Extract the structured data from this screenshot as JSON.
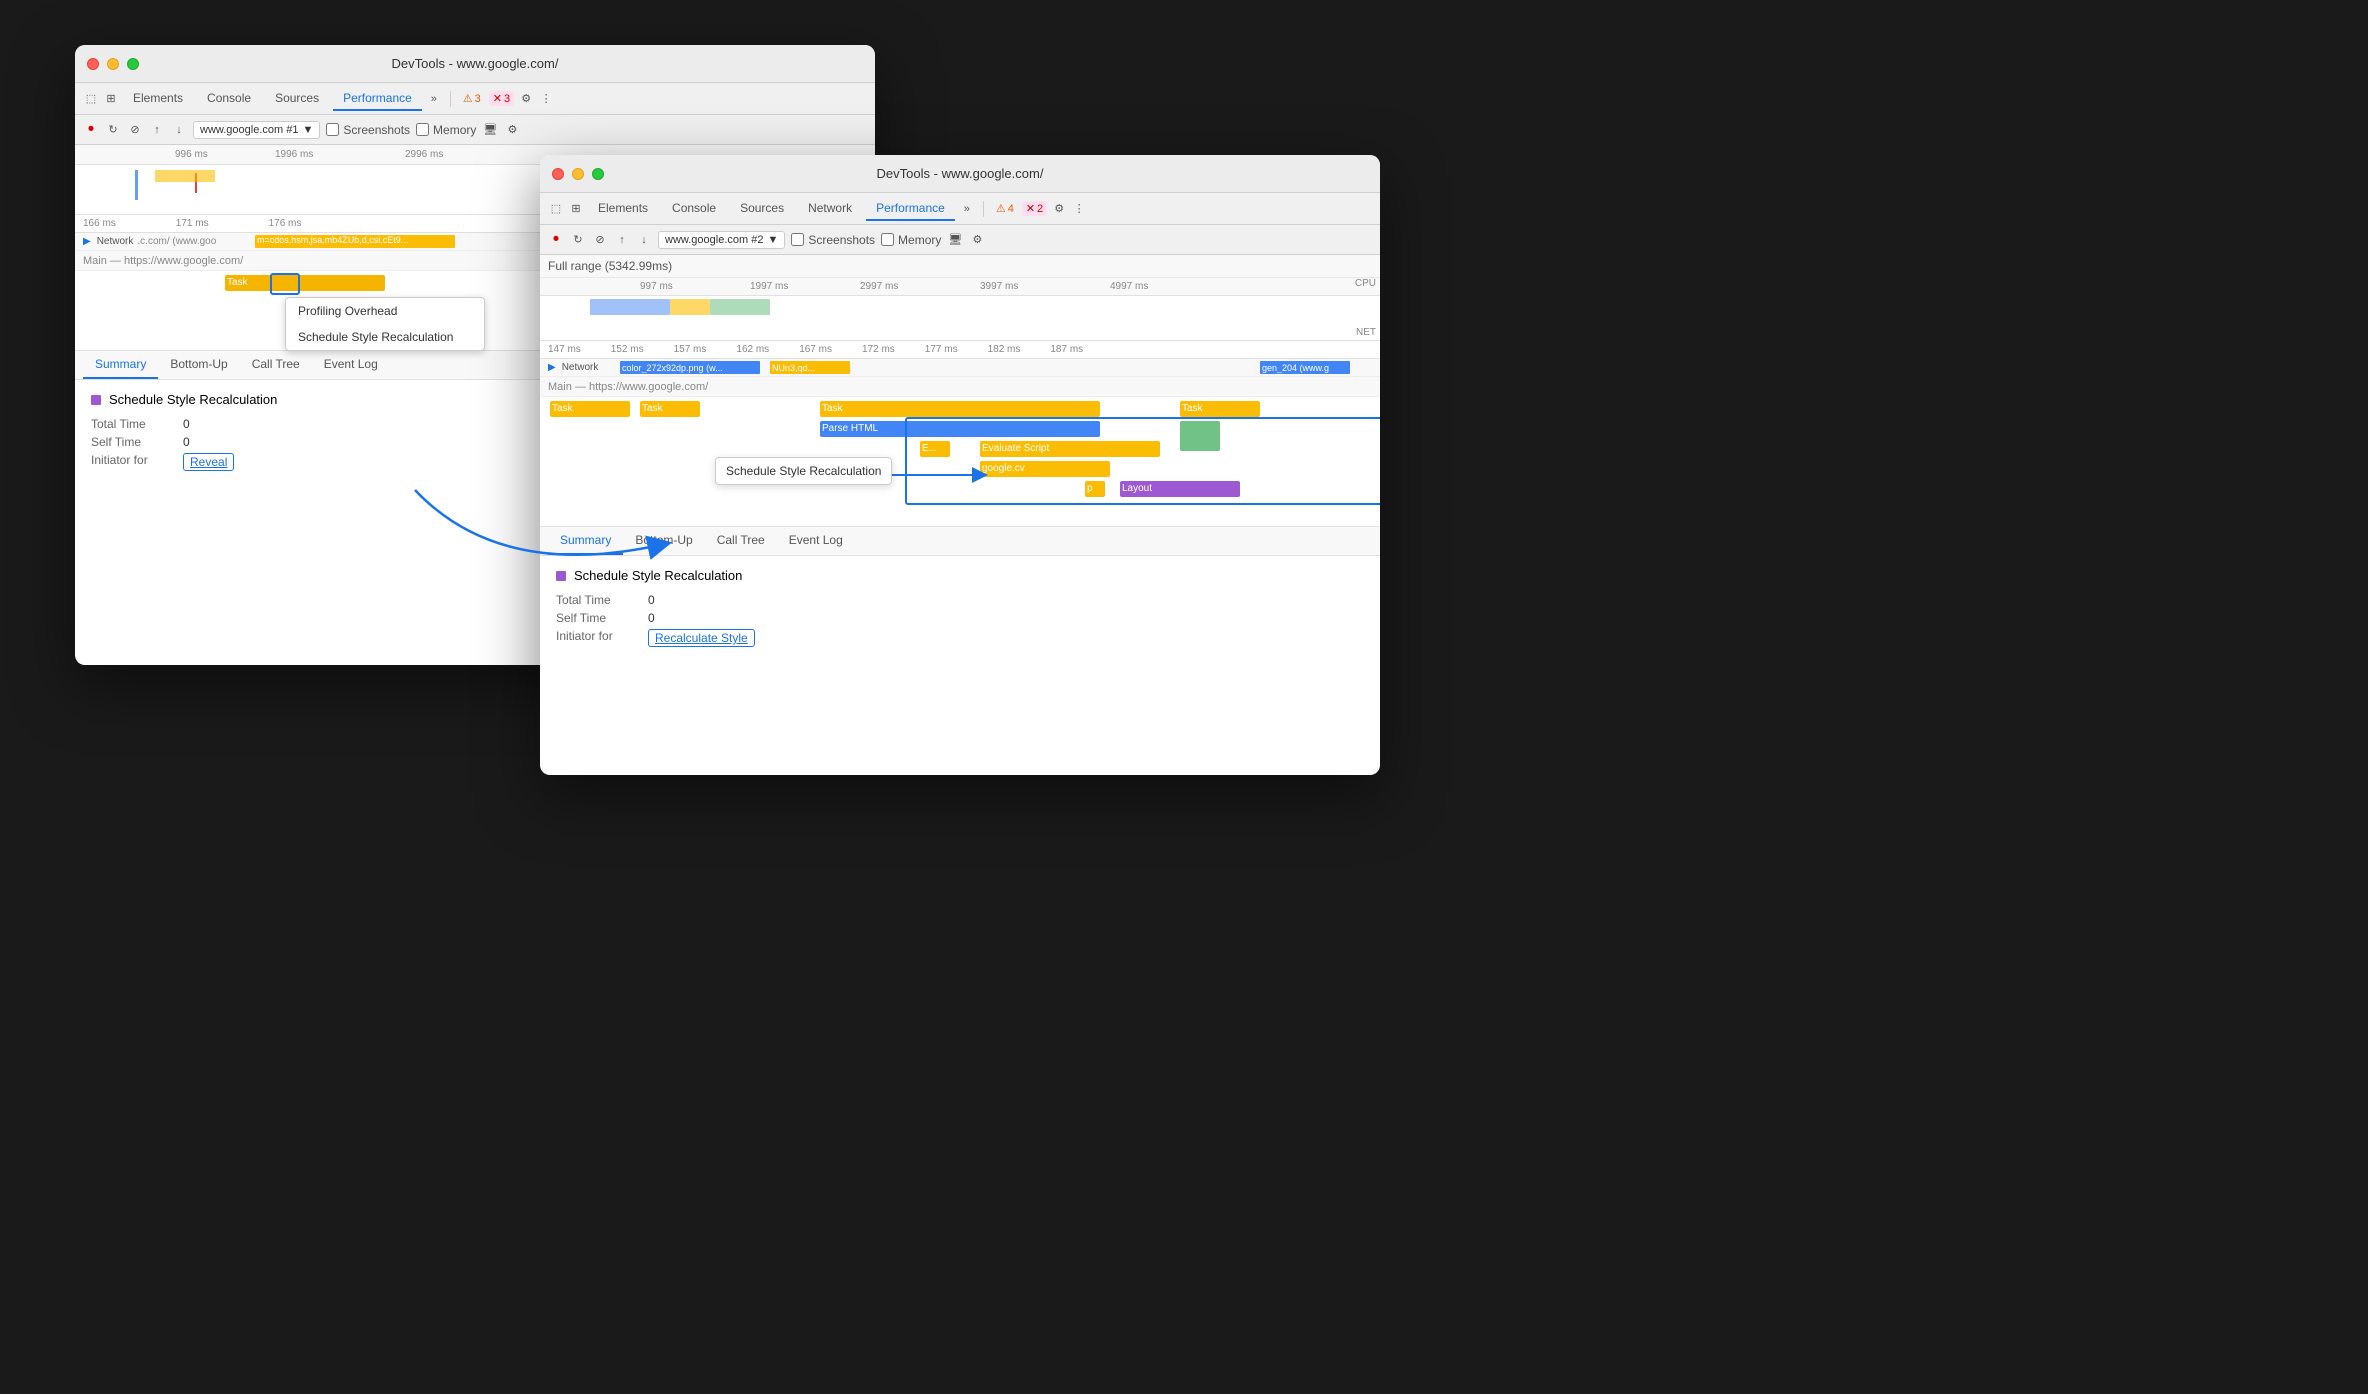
{
  "window1": {
    "title": "DevTools - www.google.com/",
    "traffic_lights": [
      "red",
      "yellow",
      "green"
    ],
    "tabs": [
      "Elements",
      "Console",
      "Sources",
      "Performance"
    ],
    "active_tab": "Performance",
    "warnings": "3",
    "errors": "3",
    "toolbar2": {
      "url": "www.google.com #1",
      "screenshots_label": "Screenshots",
      "memory_label": "Memory"
    },
    "ruler": {
      "ticks": [
        "996 ms",
        "1996 ms",
        "2996 ms"
      ]
    },
    "detail_ruler": {
      "ticks": [
        "166 ms",
        "171 ms",
        "176 ms"
      ]
    },
    "network_row": {
      "label": "Network",
      "url": ".c.com/ (www.goo",
      "params": "m=cdos,hsm,jsa,mb4ZUb,d,csi,cEt9..."
    },
    "main_section": {
      "label": "Main — https://www.google.com/",
      "tasks": [
        "Task"
      ]
    },
    "profiling_dropdown": {
      "items": [
        "Profiling Overhead",
        "Schedule Style Recalculation"
      ]
    },
    "bottom_tabs": [
      "Summary",
      "Bottom-Up",
      "Call Tree",
      "Event Log"
    ],
    "active_bottom_tab": "Summary",
    "summary": {
      "title": "Schedule Style Recalculation",
      "total_time_label": "Total Time",
      "total_time_value": "0",
      "self_time_label": "Self Time",
      "self_time_value": "0",
      "initiator_label": "Initiator for",
      "initiator_link": "Reveal"
    }
  },
  "window2": {
    "title": "DevTools - www.google.com/",
    "traffic_lights": [
      "red",
      "yellow",
      "green"
    ],
    "tabs": [
      "Elements",
      "Console",
      "Sources",
      "Network",
      "Performance"
    ],
    "active_tab": "Performance",
    "warnings": "4",
    "errors": "2",
    "toolbar2": {
      "url": "www.google.com #2",
      "screenshots_label": "Screenshots",
      "memory_label": "Memory"
    },
    "full_range": "Full range (5342.99ms)",
    "ruler": {
      "ticks": [
        "997 ms",
        "1997 ms",
        "2997 ms",
        "3997 ms",
        "4997 ms"
      ]
    },
    "detail_ruler": {
      "ticks": [
        "147 ms",
        "152 ms",
        "157 ms",
        "162 ms",
        "167 ms",
        "172 ms",
        "177 ms",
        "182 ms",
        "187 ms"
      ]
    },
    "network_row": {
      "label": "Network",
      "file1": "color_272x92dp.png (w...",
      "file2": "NUn3,qd...",
      "file3": "gen_204 (www.g"
    },
    "main_section": {
      "label": "Main — https://www.google.com/",
      "tasks": [
        "Task",
        "Task",
        "Task",
        "Task"
      ]
    },
    "flame_items": {
      "evaluate_script": "Evaluate Script",
      "google_cv": "google.cv",
      "parse_html": "Parse HTML",
      "layout": "Layout",
      "p": "p",
      "e": "E..."
    },
    "tooltip": "Schedule Style Recalculation",
    "bottom_tabs": [
      "Summary",
      "Bottom-Up",
      "Call Tree",
      "Event Log"
    ],
    "active_bottom_tab": "Summary",
    "summary": {
      "title": "Schedule Style Recalculation",
      "total_time_label": "Total Time",
      "total_time_value": "0",
      "self_time_label": "Self Time",
      "self_time_value": "0",
      "initiator_label": "Initiator for",
      "initiator_link": "Recalculate Style"
    },
    "labels": {
      "cpu": "CPU",
      "net": "NET"
    }
  },
  "icons": {
    "record": "⏺",
    "reload": "↻",
    "clear": "⊘",
    "upload": "↑",
    "download": "↓",
    "settings": "⚙",
    "more": "⋮",
    "cursor": "⬚",
    "layers": "⊞",
    "more_tabs": "»",
    "warning": "⚠",
    "error": "✕",
    "chevron": "▼",
    "right_arrow": "▶"
  }
}
